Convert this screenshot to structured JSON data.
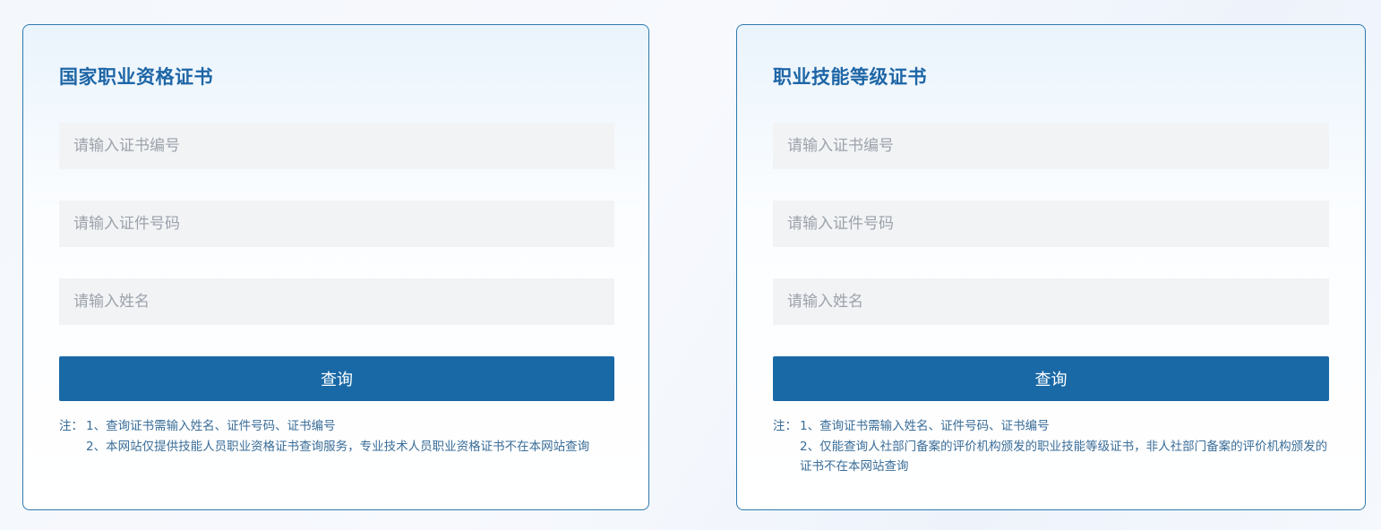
{
  "panels": [
    {
      "title": "国家职业资格证书",
      "fields": {
        "cert_no_placeholder": "请输入证书编号",
        "id_no_placeholder": "请输入证件号码",
        "name_placeholder": "请输入姓名"
      },
      "query_label": "查询",
      "notes": {
        "prefix": "注：",
        "items": [
          "1、查询证书需输入姓名、证件号码、证书编号",
          "2、本网站仅提供技能人员职业资格证书查询服务，专业技术人员职业资格证书不在本网站查询"
        ]
      }
    },
    {
      "title": "职业技能等级证书",
      "fields": {
        "cert_no_placeholder": "请输入证书编号",
        "id_no_placeholder": "请输入证件号码",
        "name_placeholder": "请输入姓名"
      },
      "query_label": "查询",
      "notes": {
        "prefix": "注：",
        "items": [
          "1、查询证书需输入姓名、证件号码、证书编号",
          "2、仅能查询人社部门备案的评价机构颁发的职业技能等级证书，非人社部门备案的评价机构颁发的证书不在本网站查询"
        ]
      }
    }
  ],
  "colors": {
    "accent": "#1a69a7",
    "title": "#1e66a6",
    "border": "#2f79ad",
    "note_text": "#3a6d98",
    "field_bg": "#f2f3f5"
  }
}
